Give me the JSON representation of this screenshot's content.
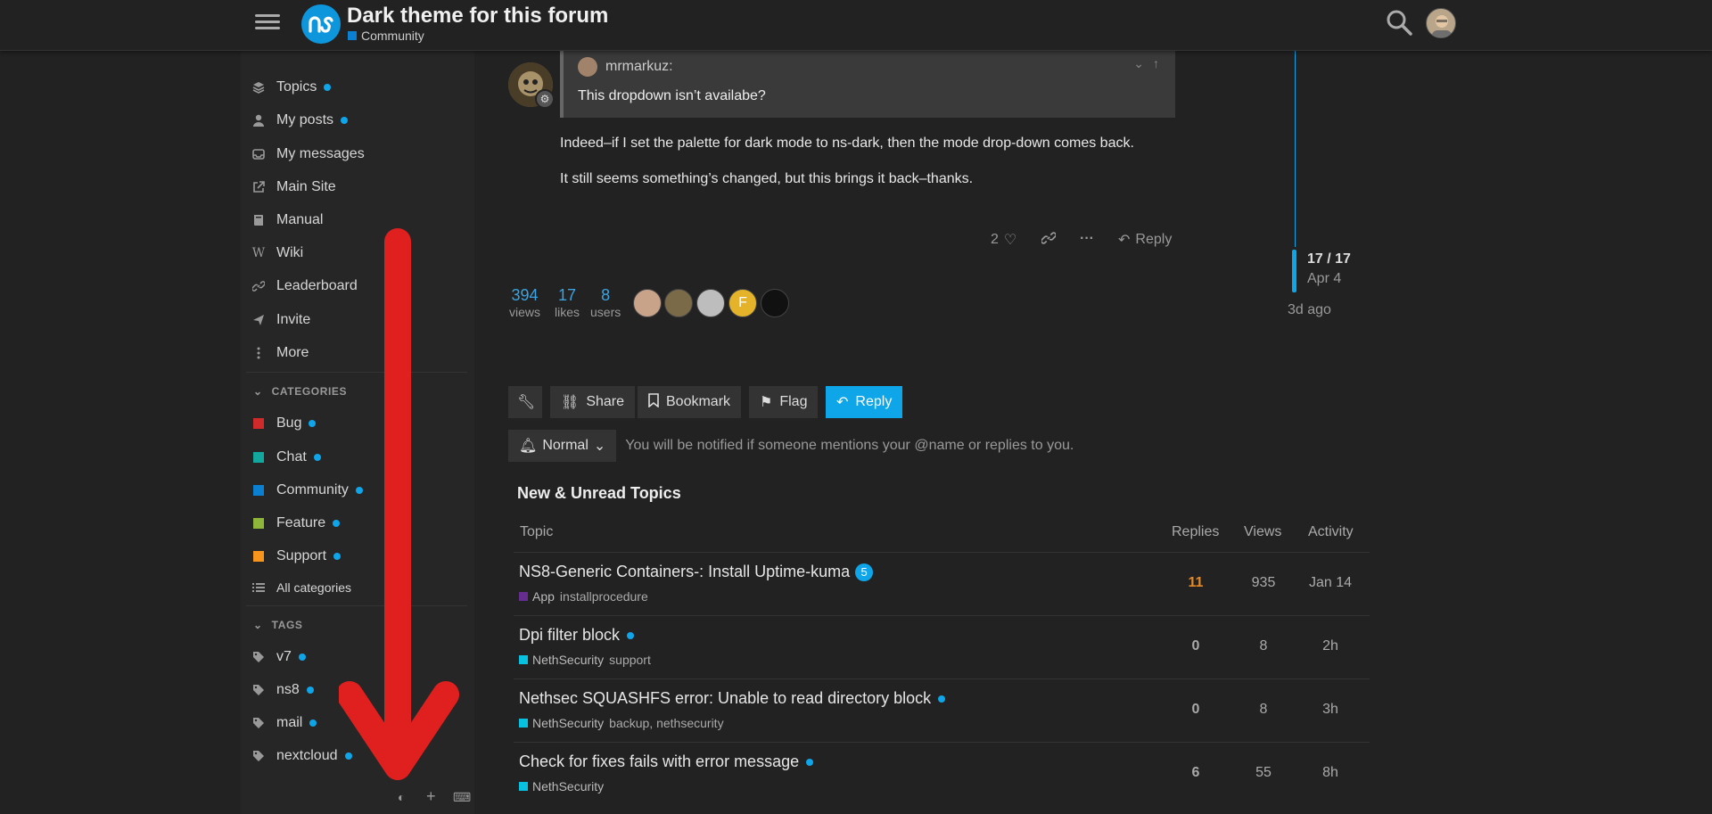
{
  "header": {
    "title": "Dark theme for this forum",
    "category": "Community",
    "category_color": "#0b7fd1",
    "logo_text": "ทร"
  },
  "sidebar": {
    "nav": [
      {
        "label": "Topics",
        "icon": "layers-icon",
        "dot": true
      },
      {
        "label": "My posts",
        "icon": "user-icon",
        "dot": true
      },
      {
        "label": "My messages",
        "icon": "inbox-icon",
        "dot": false
      },
      {
        "label": "Main Site",
        "icon": "external-link-icon",
        "dot": false
      },
      {
        "label": "Manual",
        "icon": "book-icon",
        "dot": false
      },
      {
        "label": "Wiki",
        "icon": "wikipedia-icon",
        "dot": false
      },
      {
        "label": "Leaderboard",
        "icon": "link-icon",
        "dot": false
      },
      {
        "label": "Invite",
        "icon": "send-icon",
        "dot": false
      },
      {
        "label": "More",
        "icon": "vertical-ellipsis-icon",
        "dot": false
      }
    ],
    "categories_heading": "CATEGORIES",
    "categories": [
      {
        "label": "Bug",
        "color": "#d02a2a",
        "dot": true
      },
      {
        "label": "Chat",
        "color": "#12a89d",
        "dot": true
      },
      {
        "label": "Community",
        "color": "#0b7fd1",
        "dot": true
      },
      {
        "label": "Feature",
        "color": "#8db63a",
        "dot": true
      },
      {
        "label": "Support",
        "color": "#f7941d",
        "dot": true
      }
    ],
    "all_categories": "All categories",
    "tags_heading": "TAGS",
    "tags": [
      {
        "label": "v7",
        "dot": true
      },
      {
        "label": "ns8",
        "dot": true
      },
      {
        "label": "mail",
        "dot": true
      },
      {
        "label": "nextcloud",
        "dot": true
      }
    ]
  },
  "post": {
    "quote_author": "mrmarkuz:",
    "quote_text": "This dropdown isn’t availabe?",
    "paragraphs": [
      "Indeed–if I set the palette for dark mode to ns-dark, then the mode drop-down comes back.",
      "It still seems something’s changed, but this brings it back–thanks."
    ],
    "likes": "2",
    "reply_label": "Reply"
  },
  "stats": {
    "views": "394",
    "views_label": "views",
    "likes": "17",
    "likes_label": "likes",
    "users": "8",
    "users_label": "users",
    "participant_initial": "F"
  },
  "footer_buttons": {
    "share": "Share",
    "bookmark": "Bookmark",
    "flag": "Flag",
    "reply": "Reply"
  },
  "notification": {
    "level": "Normal",
    "text": "You will be notified if someone mentions your @name or replies to you."
  },
  "suggested": {
    "title": "New & Unread Topics",
    "headers": {
      "topic": "Topic",
      "replies": "Replies",
      "views": "Views",
      "activity": "Activity"
    },
    "rows": [
      {
        "title": "NS8-Generic Containers-: Install Uptime-kuma",
        "badge": "5",
        "category": "App",
        "cat_color": "#652d90",
        "tags": "installprocedure",
        "replies": "11",
        "views": "935",
        "activity": "Jan 14"
      },
      {
        "title": "Dpi filter block",
        "badge": "",
        "category": "NethSecurity",
        "cat_color": "#08c0e0",
        "tags": "support",
        "replies": "0",
        "views": "8",
        "activity": "2h"
      },
      {
        "title": "Nethsec SQUASHFS error: Unable to read directory block",
        "badge": "",
        "category": "NethSecurity",
        "cat_color": "#08c0e0",
        "tags": "backup, nethsecurity",
        "replies": "0",
        "views": "8",
        "activity": "3h"
      },
      {
        "title": "Check for fixes fails with error message",
        "badge": "",
        "category": "NethSecurity",
        "cat_color": "#08c0e0",
        "tags": "",
        "replies": "6",
        "views": "55",
        "activity": "8h"
      }
    ]
  },
  "timeline": {
    "position": "17 / 17",
    "date": "Apr 4",
    "ago": "3d ago"
  },
  "colors": {
    "accent": "#0ea5e9",
    "annotation_arrow": "#e0201f",
    "hot_replies": "#e08a2a"
  }
}
